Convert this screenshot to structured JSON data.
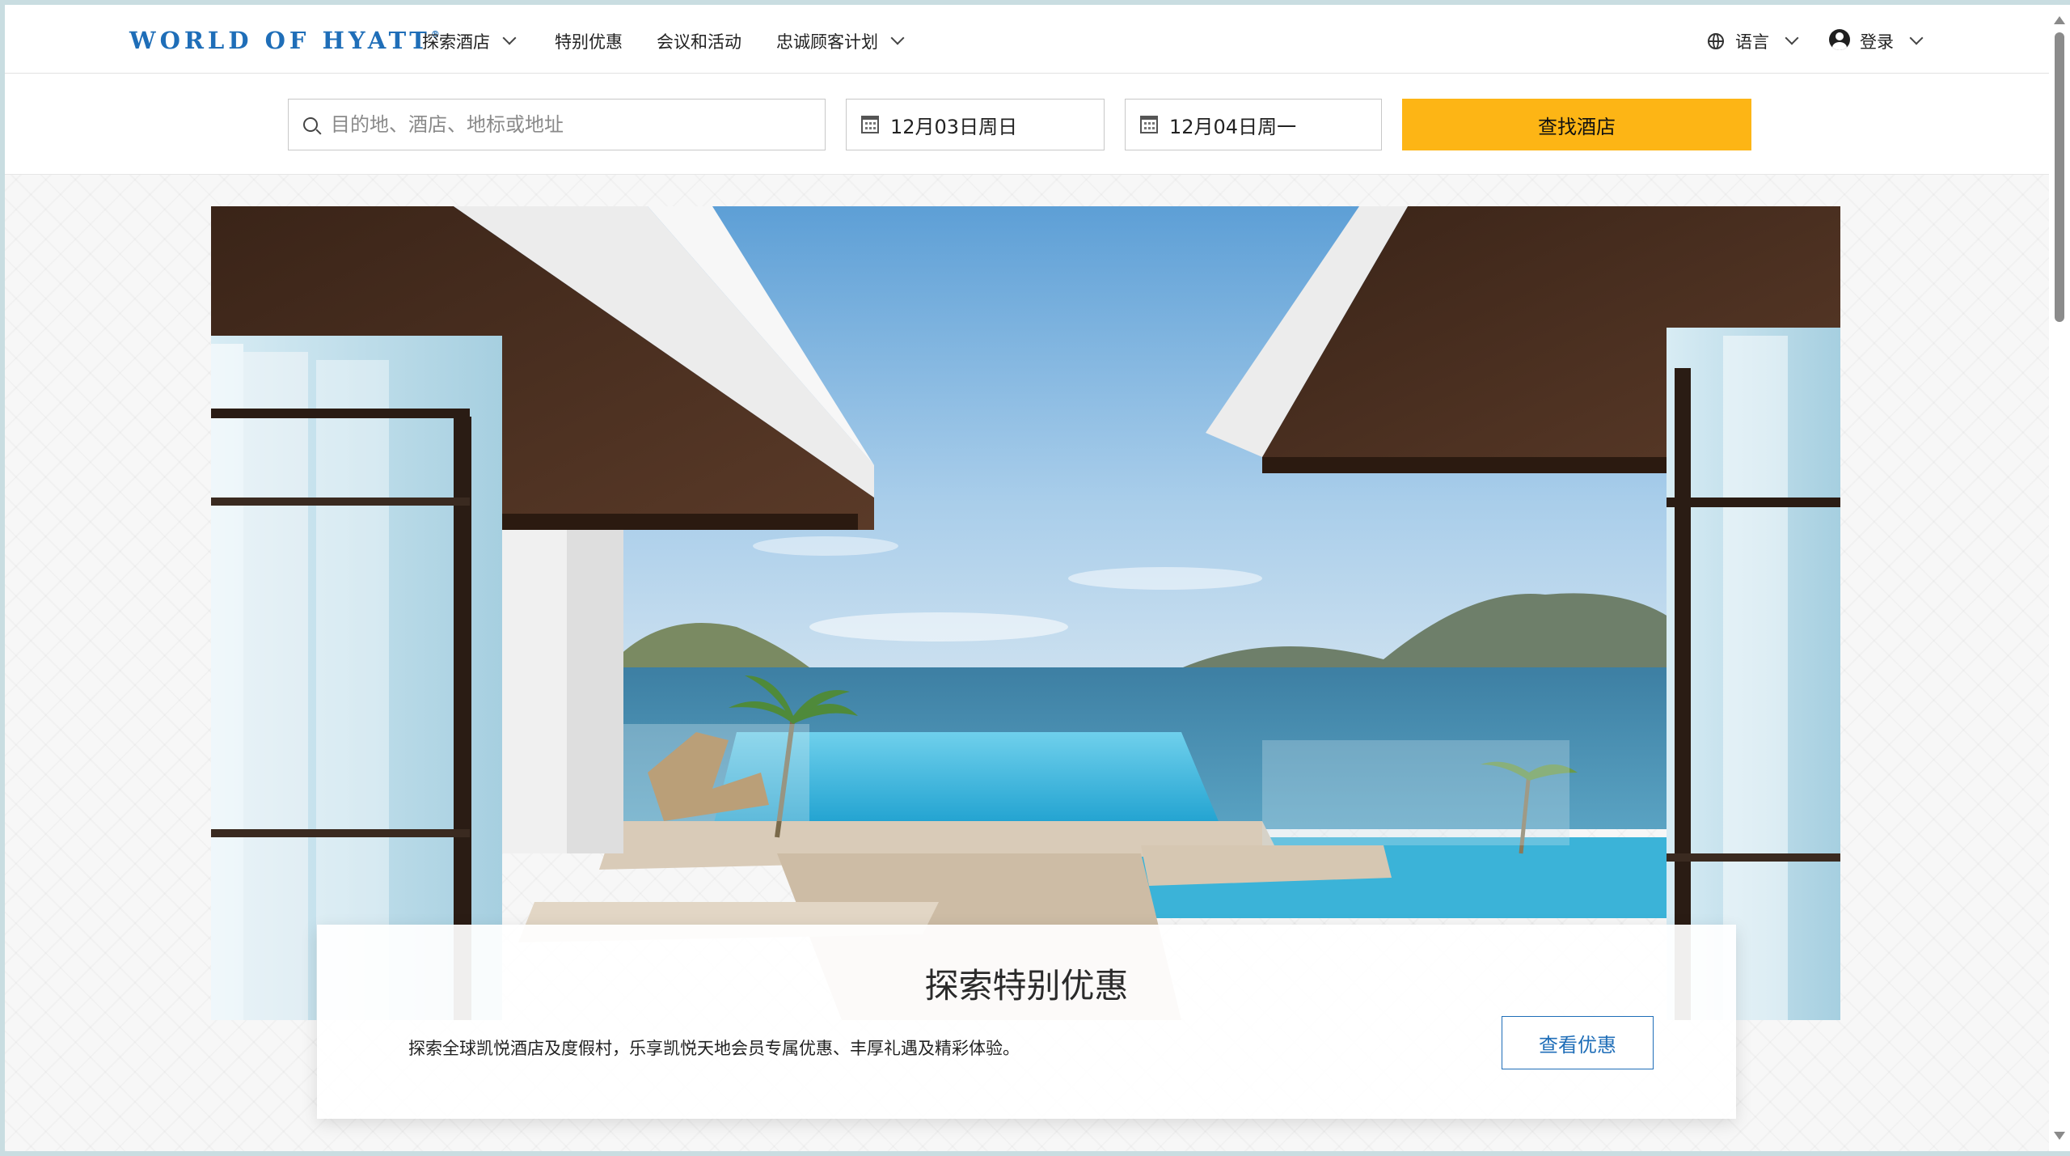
{
  "header": {
    "logo_text": "WORLD OF HYATT",
    "logo_mark": "®",
    "nav": [
      {
        "label": "探索酒店",
        "dropdown": true
      },
      {
        "label": "特别优惠",
        "dropdown": false
      },
      {
        "label": "会议和活动",
        "dropdown": false
      },
      {
        "label": "忠诚顾客计划",
        "dropdown": true
      }
    ],
    "language_label": "语言",
    "login_label": "登录"
  },
  "search": {
    "destination_placeholder": "目的地、酒店、地标或地址",
    "checkin": "12月03日周日",
    "checkout": "12月04日周一",
    "button_label": "查找酒店"
  },
  "promo": {
    "title": "探索特别优惠",
    "description": "探索全球凯悦酒店及度假村，乐享凯悦天地会员专属优惠、丰厚礼遇及精彩体验。",
    "button_label": "查看优惠"
  },
  "colors": {
    "brand_blue": "#1f6eb8",
    "cta_yellow": "#fdb515"
  }
}
